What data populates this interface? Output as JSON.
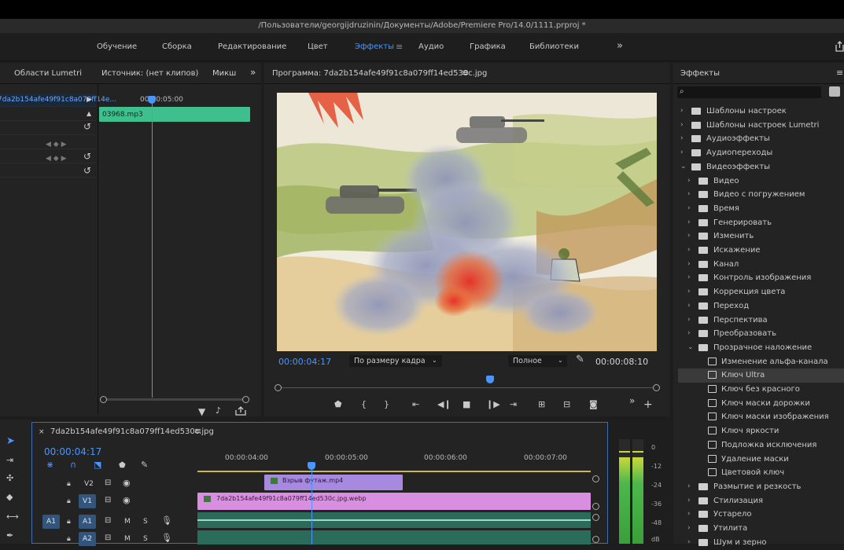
{
  "title": "/Пользователи/georgijdruzinin/Документы/Adobe/Premiere Pro/14.0/1111.prproj *",
  "workspaces": [
    "Обучение",
    "Сборка",
    "Редактирование",
    "Цвет",
    "Эффекты",
    "Аудио",
    "Графика",
    "Библиотеки"
  ],
  "workspace_more": "»",
  "source_panel": {
    "tabs": [
      "Области Lumetri",
      "Источник: (нет клипов)",
      "Микш"
    ],
    "more": "»",
    "clip_name": "7da2b154afe49f91c8a079ff14e...",
    "time": "00:00:05:00",
    "audio_clip": "03968.mp3"
  },
  "program_panel": {
    "title": "Программа: 7da2b154afe49f91c8a079ff14ed530c.jpg",
    "current_time": "00:00:04:17",
    "fit": "По размеру кадра",
    "quality": "Полное",
    "duration": "00:00:08:10",
    "playhead_fraction": 0.56
  },
  "effects_panel": {
    "title": "Эффекты",
    "search_placeholder": "",
    "items": [
      {
        "label": "Шаблоны настроек",
        "level": 0,
        "kind": "preset-folder",
        "expanded": false
      },
      {
        "label": "Шаблоны настроек Lumetri",
        "level": 0,
        "kind": "preset-folder",
        "expanded": false
      },
      {
        "label": "Аудиоэффекты",
        "level": 0,
        "kind": "folder",
        "expanded": false
      },
      {
        "label": "Аудиопереходы",
        "level": 0,
        "kind": "folder",
        "expanded": false
      },
      {
        "label": "Видеоэффекты",
        "level": 0,
        "kind": "folder",
        "expanded": true
      },
      {
        "label": "Видео",
        "level": 1,
        "kind": "folder",
        "expanded": false
      },
      {
        "label": "Видео с погружением",
        "level": 1,
        "kind": "folder",
        "expanded": false
      },
      {
        "label": "Время",
        "level": 1,
        "kind": "folder",
        "expanded": false
      },
      {
        "label": "Генерировать",
        "level": 1,
        "kind": "folder",
        "expanded": false
      },
      {
        "label": "Изменить",
        "level": 1,
        "kind": "folder",
        "expanded": false
      },
      {
        "label": "Искажение",
        "level": 1,
        "kind": "folder",
        "expanded": false
      },
      {
        "label": "Канал",
        "level": 1,
        "kind": "folder",
        "expanded": false
      },
      {
        "label": "Контроль изображения",
        "level": 1,
        "kind": "folder",
        "expanded": false
      },
      {
        "label": "Коррекция цвета",
        "level": 1,
        "kind": "folder",
        "expanded": false
      },
      {
        "label": "Переход",
        "level": 1,
        "kind": "folder",
        "expanded": false
      },
      {
        "label": "Перспектива",
        "level": 1,
        "kind": "folder",
        "expanded": false
      },
      {
        "label": "Преобразовать",
        "level": 1,
        "kind": "folder",
        "expanded": false
      },
      {
        "label": "Прозрачное наложение",
        "level": 1,
        "kind": "folder",
        "expanded": true
      },
      {
        "label": "Изменение альфа-канала",
        "level": 2,
        "kind": "effect"
      },
      {
        "label": "Ключ Ultra",
        "level": 2,
        "kind": "effect",
        "selected": true
      },
      {
        "label": "Ключ без красного",
        "level": 2,
        "kind": "effect"
      },
      {
        "label": "Ключ маски дорожки",
        "level": 2,
        "kind": "effect"
      },
      {
        "label": "Ключ маски изображения",
        "level": 2,
        "kind": "effect"
      },
      {
        "label": "Ключ яркости",
        "level": 2,
        "kind": "effect"
      },
      {
        "label": "Подложка исключения",
        "level": 2,
        "kind": "effect"
      },
      {
        "label": "Удаление маски",
        "level": 2,
        "kind": "effect"
      },
      {
        "label": "Цветовой ключ",
        "level": 2,
        "kind": "effect"
      },
      {
        "label": "Размытие и резкость",
        "level": 1,
        "kind": "folder",
        "expanded": false
      },
      {
        "label": "Стилизация",
        "level": 1,
        "kind": "folder",
        "expanded": false
      },
      {
        "label": "Устарело",
        "level": 1,
        "kind": "folder",
        "expanded": false
      },
      {
        "label": "Утилита",
        "level": 1,
        "kind": "folder",
        "expanded": false
      },
      {
        "label": "Шум и зерно",
        "level": 1,
        "kind": "folder",
        "expanded": false
      }
    ]
  },
  "timeline": {
    "close": "×",
    "sequence_name": "7da2b154afe49f91c8a079ff14ed530c.jpg",
    "current_time": "00:00:04:17",
    "ticks": [
      "00:00:04:00",
      "00:00:05:00",
      "00:00:06:00",
      "00:00:07:00"
    ],
    "tracks": [
      {
        "id": "V2",
        "kind": "video"
      },
      {
        "id": "V1",
        "kind": "video"
      },
      {
        "id": "A1",
        "kind": "audio",
        "source": "A1"
      },
      {
        "id": "A2",
        "kind": "audio"
      }
    ],
    "track_m": "M",
    "track_s": "S",
    "clips": {
      "v2": "Взрыв футаж.mp4",
      "v1": "7da2b154afe49f91c8a079ff14ed530c.jpg.webp"
    }
  },
  "meter": {
    "labels": [
      "0",
      "-12",
      "-24",
      "-36",
      "-48",
      "dB"
    ]
  },
  "colors": {
    "accent": "#4b95ff",
    "audio_clip": "#3fbf8e",
    "v1_clip": "#d98fe0",
    "v2_clip": "#a889e0",
    "audio_track": "#2b6b5a"
  }
}
